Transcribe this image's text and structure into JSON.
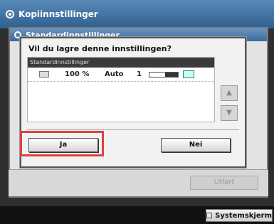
{
  "window": {
    "title": "Kopiinnstillinger"
  },
  "panel": {
    "title": "Standardinnstillinger"
  },
  "dialog": {
    "question": "Vil du lagre denne innstillingen?",
    "list_header": "Standardinnstillinger",
    "row": {
      "zoom": "100 %",
      "paper": "Auto",
      "copies": "1"
    },
    "yes_label": "Ja",
    "no_label": "Nei"
  },
  "footer": {
    "done_label": "Utført"
  },
  "bottom": {
    "system_label": "Systemskjerm"
  },
  "icons": {
    "title": "settings-icon",
    "panel": "settings-icon",
    "paper": "paper-icon",
    "density": "density-bar-icon",
    "finish": "finishing-icon",
    "scroll_up": "arrow-up-icon",
    "scroll_down": "arrow-down-icon"
  },
  "colors": {
    "title_bar": "#2f5f8f",
    "highlight": "#e04040"
  }
}
